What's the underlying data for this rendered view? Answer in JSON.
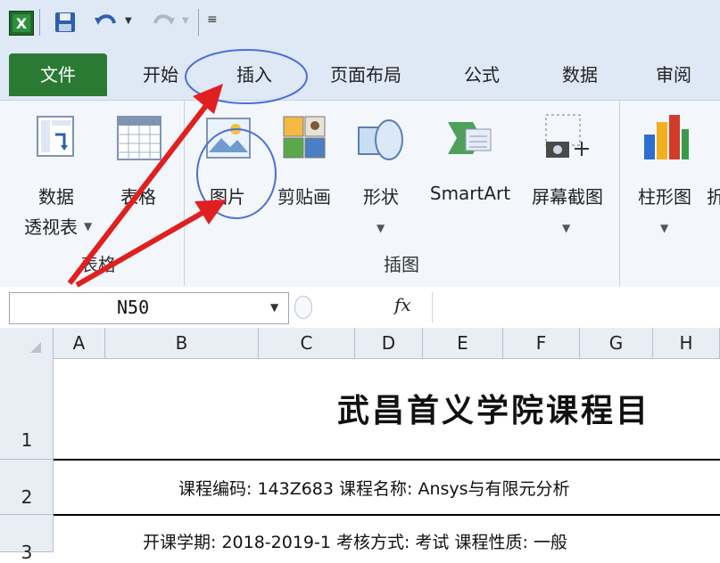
{
  "quick_access": {
    "app_icon": "excel-icon",
    "save_icon": "save-icon",
    "undo_icon": "undo-icon",
    "redo_icon": "redo-icon",
    "customize_icon": "customize-icon"
  },
  "tabs": [
    {
      "label": "文件"
    },
    {
      "label": "开始"
    },
    {
      "label": "插入"
    },
    {
      "label": "页面布局"
    },
    {
      "label": "公式"
    },
    {
      "label": "数据"
    },
    {
      "label": "审阅"
    }
  ],
  "ribbon": {
    "group_tables": {
      "label": "表格",
      "pivot_line1": "数据",
      "pivot_line2": "透视表",
      "table_label": "表格"
    },
    "group_illustrations": {
      "label": "插图",
      "picture_label": "图片",
      "clipart_label": "剪贴画",
      "shapes_label": "形状",
      "smartart_label": "SmartArt",
      "screenshot_label": "屏幕截图"
    },
    "group_charts": {
      "column_label": "柱形图",
      "next_label": "折"
    }
  },
  "formula_bar": {
    "cell_ref": "N50",
    "fx": "fx",
    "value": ""
  },
  "columns": [
    "A",
    "B",
    "C",
    "D",
    "E",
    "F",
    "G",
    "H"
  ],
  "rows": [
    "1",
    "2",
    "3"
  ],
  "sheet": {
    "title": "武昌首义学院课程目",
    "row2": "课程编码: 143Z683    课程名称: Ansys与有限元分析",
    "row3": "开课学期: 2018-2019-1   考核方式: 考试   课程性质: 一般"
  },
  "colors": {
    "file_tab": "#2a7a33",
    "annotation_red": "#e02020",
    "annotation_blue": "#4a6fd8"
  }
}
